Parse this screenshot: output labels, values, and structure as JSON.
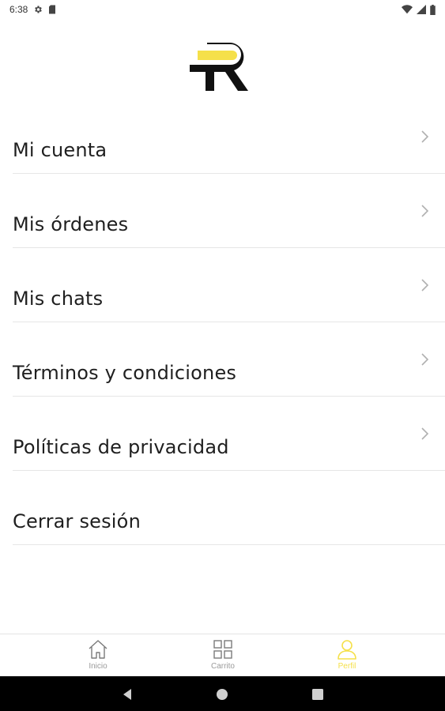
{
  "status_bar": {
    "time": "6:38",
    "icons": [
      "gear-icon",
      "sd-card-icon",
      "wifi-icon",
      "signal-icon",
      "battery-icon"
    ]
  },
  "logo": {
    "name": "r-brand-logo",
    "accent_color": "#f5e04a"
  },
  "menu": {
    "items": [
      {
        "label": "Mi cuenta",
        "has_chevron": true
      },
      {
        "label": "Mis órdenes",
        "has_chevron": true
      },
      {
        "label": "Mis chats",
        "has_chevron": true
      },
      {
        "label": "Términos y condiciones",
        "has_chevron": true
      },
      {
        "label": "Políticas de privacidad",
        "has_chevron": true
      },
      {
        "label": "Cerrar sesión",
        "has_chevron": false
      }
    ]
  },
  "bottom_nav": {
    "items": [
      {
        "label": "Inicio",
        "icon": "home-icon",
        "active": false
      },
      {
        "label": "Carrito",
        "icon": "grid-icon",
        "active": false
      },
      {
        "label": "Perfil",
        "icon": "person-icon",
        "active": true
      }
    ],
    "active_color": "#f5e04a",
    "inactive_color": "#9a9a9a"
  },
  "system_nav": {
    "buttons": [
      "back-icon",
      "home-circle-icon",
      "recents-icon"
    ]
  }
}
